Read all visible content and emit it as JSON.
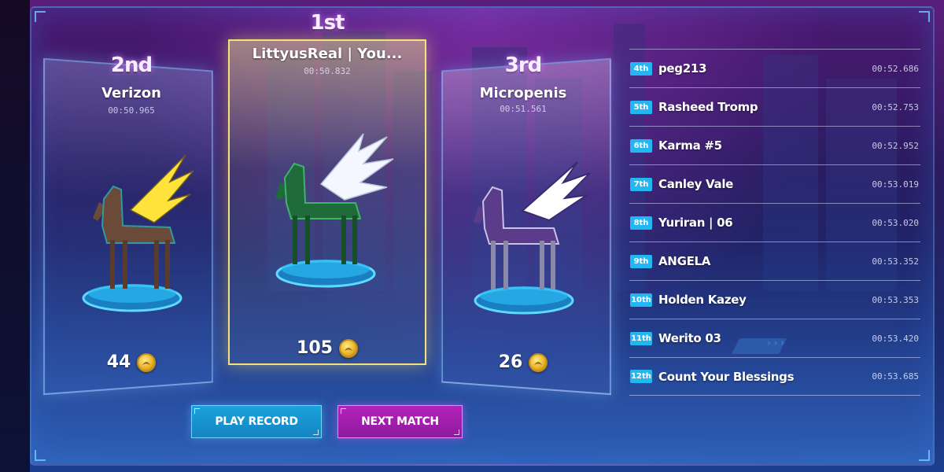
{
  "podium": {
    "first": {
      "place": "1st",
      "name": "LittyusReal | You...",
      "time": "00:50.832",
      "reward": "105",
      "horse_colors": {
        "body": "#1f6b3a",
        "accent": "#3fb36a",
        "wing": "#f4f7ff"
      }
    },
    "second": {
      "place": "2nd",
      "name": "Verizon",
      "time": "00:50.965",
      "reward": "44",
      "horse_colors": {
        "body": "#6b4a3a",
        "accent": "#2f9b9b",
        "wing": "#ffe23a"
      }
    },
    "third": {
      "place": "3rd",
      "name": "Micropenis",
      "time": "00:51.561",
      "reward": "26",
      "horse_colors": {
        "body": "#5a3c8a",
        "accent": "#c9c2e8",
        "wing": "#ffffff"
      }
    }
  },
  "leaderboard": [
    {
      "rank": "4th",
      "name": "peg213",
      "time": "00:52.686"
    },
    {
      "rank": "5th",
      "name": "Rasheed Tromp",
      "time": "00:52.753"
    },
    {
      "rank": "6th",
      "name": "Karma #5",
      "time": "00:52.952"
    },
    {
      "rank": "7th",
      "name": "Canley Vale",
      "time": "00:53.019"
    },
    {
      "rank": "8th",
      "name": "Yuriran | 06",
      "time": "00:53.020"
    },
    {
      "rank": "9th",
      "name": "ANGELA",
      "time": "00:53.352"
    },
    {
      "rank": "10th",
      "name": "Holden Kazey",
      "time": "00:53.353"
    },
    {
      "rank": "11th",
      "name": "Werito 03",
      "time": "00:53.420"
    },
    {
      "rank": "12th",
      "name": "Count Your Blessings",
      "time": "00:53.685"
    }
  ],
  "buttons": {
    "play_record": "PLAY RECORD",
    "next_match": "NEXT MATCH"
  },
  "icons": {
    "coin": "coin-icon",
    "horse": "horse-figure",
    "platform": "display-platform"
  },
  "colors": {
    "rank_badge": "#22b7f2",
    "play_button": "#1a96d2",
    "next_button": "#a51eae",
    "first_border": "#f3e27a"
  }
}
